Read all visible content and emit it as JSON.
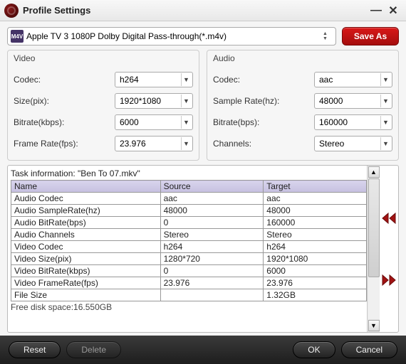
{
  "window": {
    "title": "Profile Settings",
    "minimize": "—",
    "close": "✕"
  },
  "profile": {
    "icon_text": "M4V",
    "selected": "Apple TV 3 1080P Dolby Digital Pass-through(*.m4v)",
    "saveas_label": "Save As"
  },
  "video": {
    "legend": "Video",
    "codec_label": "Codec:",
    "codec": "h264",
    "size_label": "Size(pix):",
    "size": "1920*1080",
    "bitrate_label": "Bitrate(kbps):",
    "bitrate": "6000",
    "framerate_label": "Frame Rate(fps):",
    "framerate": "23.976"
  },
  "audio": {
    "legend": "Audio",
    "codec_label": "Codec:",
    "codec": "aac",
    "samplerate_label": "Sample Rate(hz):",
    "samplerate": "48000",
    "bitrate_label": "Bitrate(bps):",
    "bitrate": "160000",
    "channels_label": "Channels:",
    "channels": "Stereo"
  },
  "task": {
    "title": "Task information: \"Ben To 07.mkv\"",
    "headers": {
      "name": "Name",
      "source": "Source",
      "target": "Target"
    },
    "rows": [
      {
        "name": "Audio Codec",
        "source": "aac",
        "target": "aac"
      },
      {
        "name": "Audio SampleRate(hz)",
        "source": "48000",
        "target": "48000"
      },
      {
        "name": "Audio BitRate(bps)",
        "source": "0",
        "target": "160000"
      },
      {
        "name": "Audio Channels",
        "source": "Stereo",
        "target": "Stereo"
      },
      {
        "name": "Video Codec",
        "source": "h264",
        "target": "h264"
      },
      {
        "name": "Video Size(pix)",
        "source": "1280*720",
        "target": "1920*1080"
      },
      {
        "name": "Video BitRate(kbps)",
        "source": "0",
        "target": "6000"
      },
      {
        "name": "Video FrameRate(fps)",
        "source": "23.976",
        "target": "23.976"
      },
      {
        "name": "File Size",
        "source": "",
        "target": "1.32GB"
      }
    ],
    "free_disk": "Free disk space:16.550GB"
  },
  "footer": {
    "reset": "Reset",
    "delete": "Delete",
    "ok": "OK",
    "cancel": "Cancel"
  }
}
